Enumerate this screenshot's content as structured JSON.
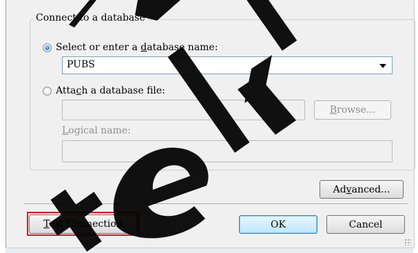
{
  "group": {
    "title": "Connect to a database"
  },
  "select_db": {
    "label_pre": "Select or enter a ",
    "label_accel": "d",
    "label_post": "atabase name:",
    "value": "PUBS"
  },
  "attach_db": {
    "label_pre": "Atta",
    "label_accel": "c",
    "label_post": "h a database file:",
    "browse_accel": "B",
    "browse_rest": "rowse...",
    "logical_accel": "L",
    "logical_rest": "ogical name:"
  },
  "buttons": {
    "advanced_pre": "Ad",
    "advanced_accel": "v",
    "advanced_post": "anced...",
    "test_accel": "T",
    "test_rest": "est Connection",
    "ok": "OK",
    "cancel": "Cancel"
  },
  "icons": {
    "dropdown": "chevron-down-icon",
    "resize": "resize-grip-icon"
  },
  "colors": {
    "highlight": "#e0141e",
    "watermark": "#000000",
    "default_button": "#3c7fb1"
  }
}
